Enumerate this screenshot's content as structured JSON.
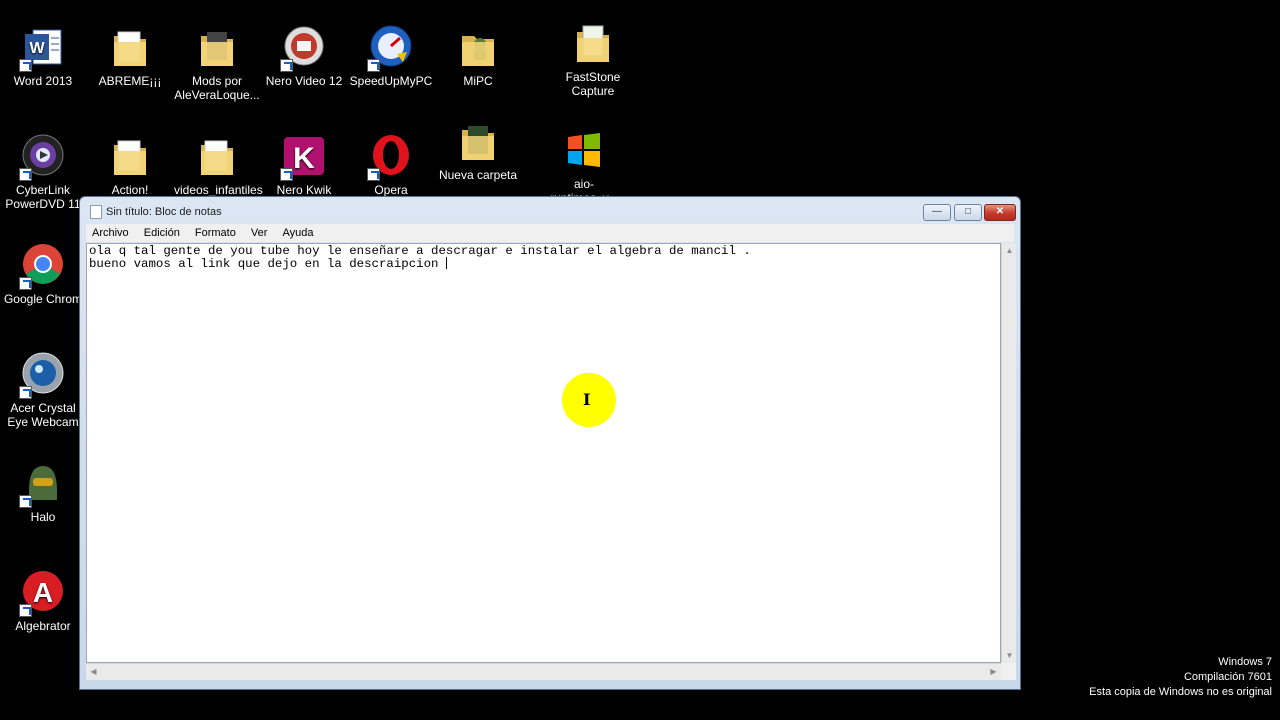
{
  "desktop": {
    "icons": [
      {
        "label": "Word 2013"
      },
      {
        "label": "ABREME¡¡¡"
      },
      {
        "label": "Mods por AleVeraLoque..."
      },
      {
        "label": "Nero Video 12"
      },
      {
        "label": "SpeedUpMyPC"
      },
      {
        "label": "MiPC"
      },
      {
        "label": "FastStone Capture"
      },
      {
        "label": "CyberLink PowerDVD 11"
      },
      {
        "label": "Action!"
      },
      {
        "label": "videos_infantiles"
      },
      {
        "label": "Nero Kwik"
      },
      {
        "label": "Opera"
      },
      {
        "label": "Nueva carpeta"
      },
      {
        "label": "aio-runtimes_v..."
      },
      {
        "label": "Google Chrom"
      },
      {
        "label": "Acer Crystal Eye Webcam"
      },
      {
        "label": "Halo"
      },
      {
        "label": "Algebrator"
      }
    ]
  },
  "window": {
    "title": "Sin título: Bloc de notas",
    "menu": [
      "Archivo",
      "Edición",
      "Formato",
      "Ver",
      "Ayuda"
    ],
    "content_line1": "ola q tal gente de you tube hoy le enseñare a descragar e instalar el algebra de mancil .",
    "content_line2": "bueno vamos al link que dejo en la descraipcion "
  },
  "watermark": {
    "line1": "Windows 7",
    "line2": "Compilación  7601",
    "line3": "Esta copia de Windows no es original"
  },
  "colors": {
    "desktop_bg": "#000000",
    "cursor_highlight": "#ffff00",
    "close_button": "#c5392a"
  }
}
